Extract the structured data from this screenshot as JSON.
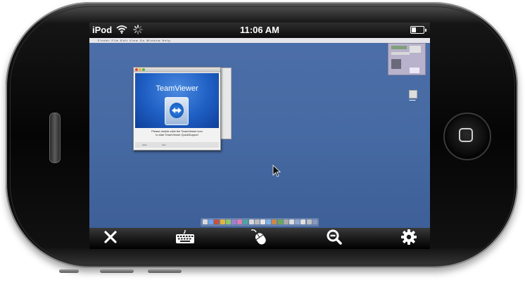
{
  "status_bar": {
    "carrier": "iPod",
    "time": "11:06 AM",
    "wifi_icon": "wifi-icon",
    "activity_icon": "spinner-icon",
    "battery_icon": "battery-icon",
    "battery_level": 0.4
  },
  "remote_desktop": {
    "menubar": {
      "menus": "Finder File Edit View Go Window Help",
      "right": ""
    },
    "teamviewer_window": {
      "brand": "TeamViewer",
      "message_line1": "Please double-click the TeamViewer icon",
      "message_line2": "to start TeamViewer QuickSupport"
    },
    "background_color": "#466aa3"
  },
  "toolbar": {
    "close_icon": "close-icon",
    "keyboard_icon": "keyboard-icon",
    "mouse_icon": "mouse-icon",
    "zoom_icon": "zoom-out-icon",
    "settings_icon": "gear-icon"
  },
  "colors": {
    "device": "#050505",
    "toolbar": "#1a1a1a",
    "desktop": "#466aa3",
    "teamviewer_blue": "#1f5fc4"
  }
}
